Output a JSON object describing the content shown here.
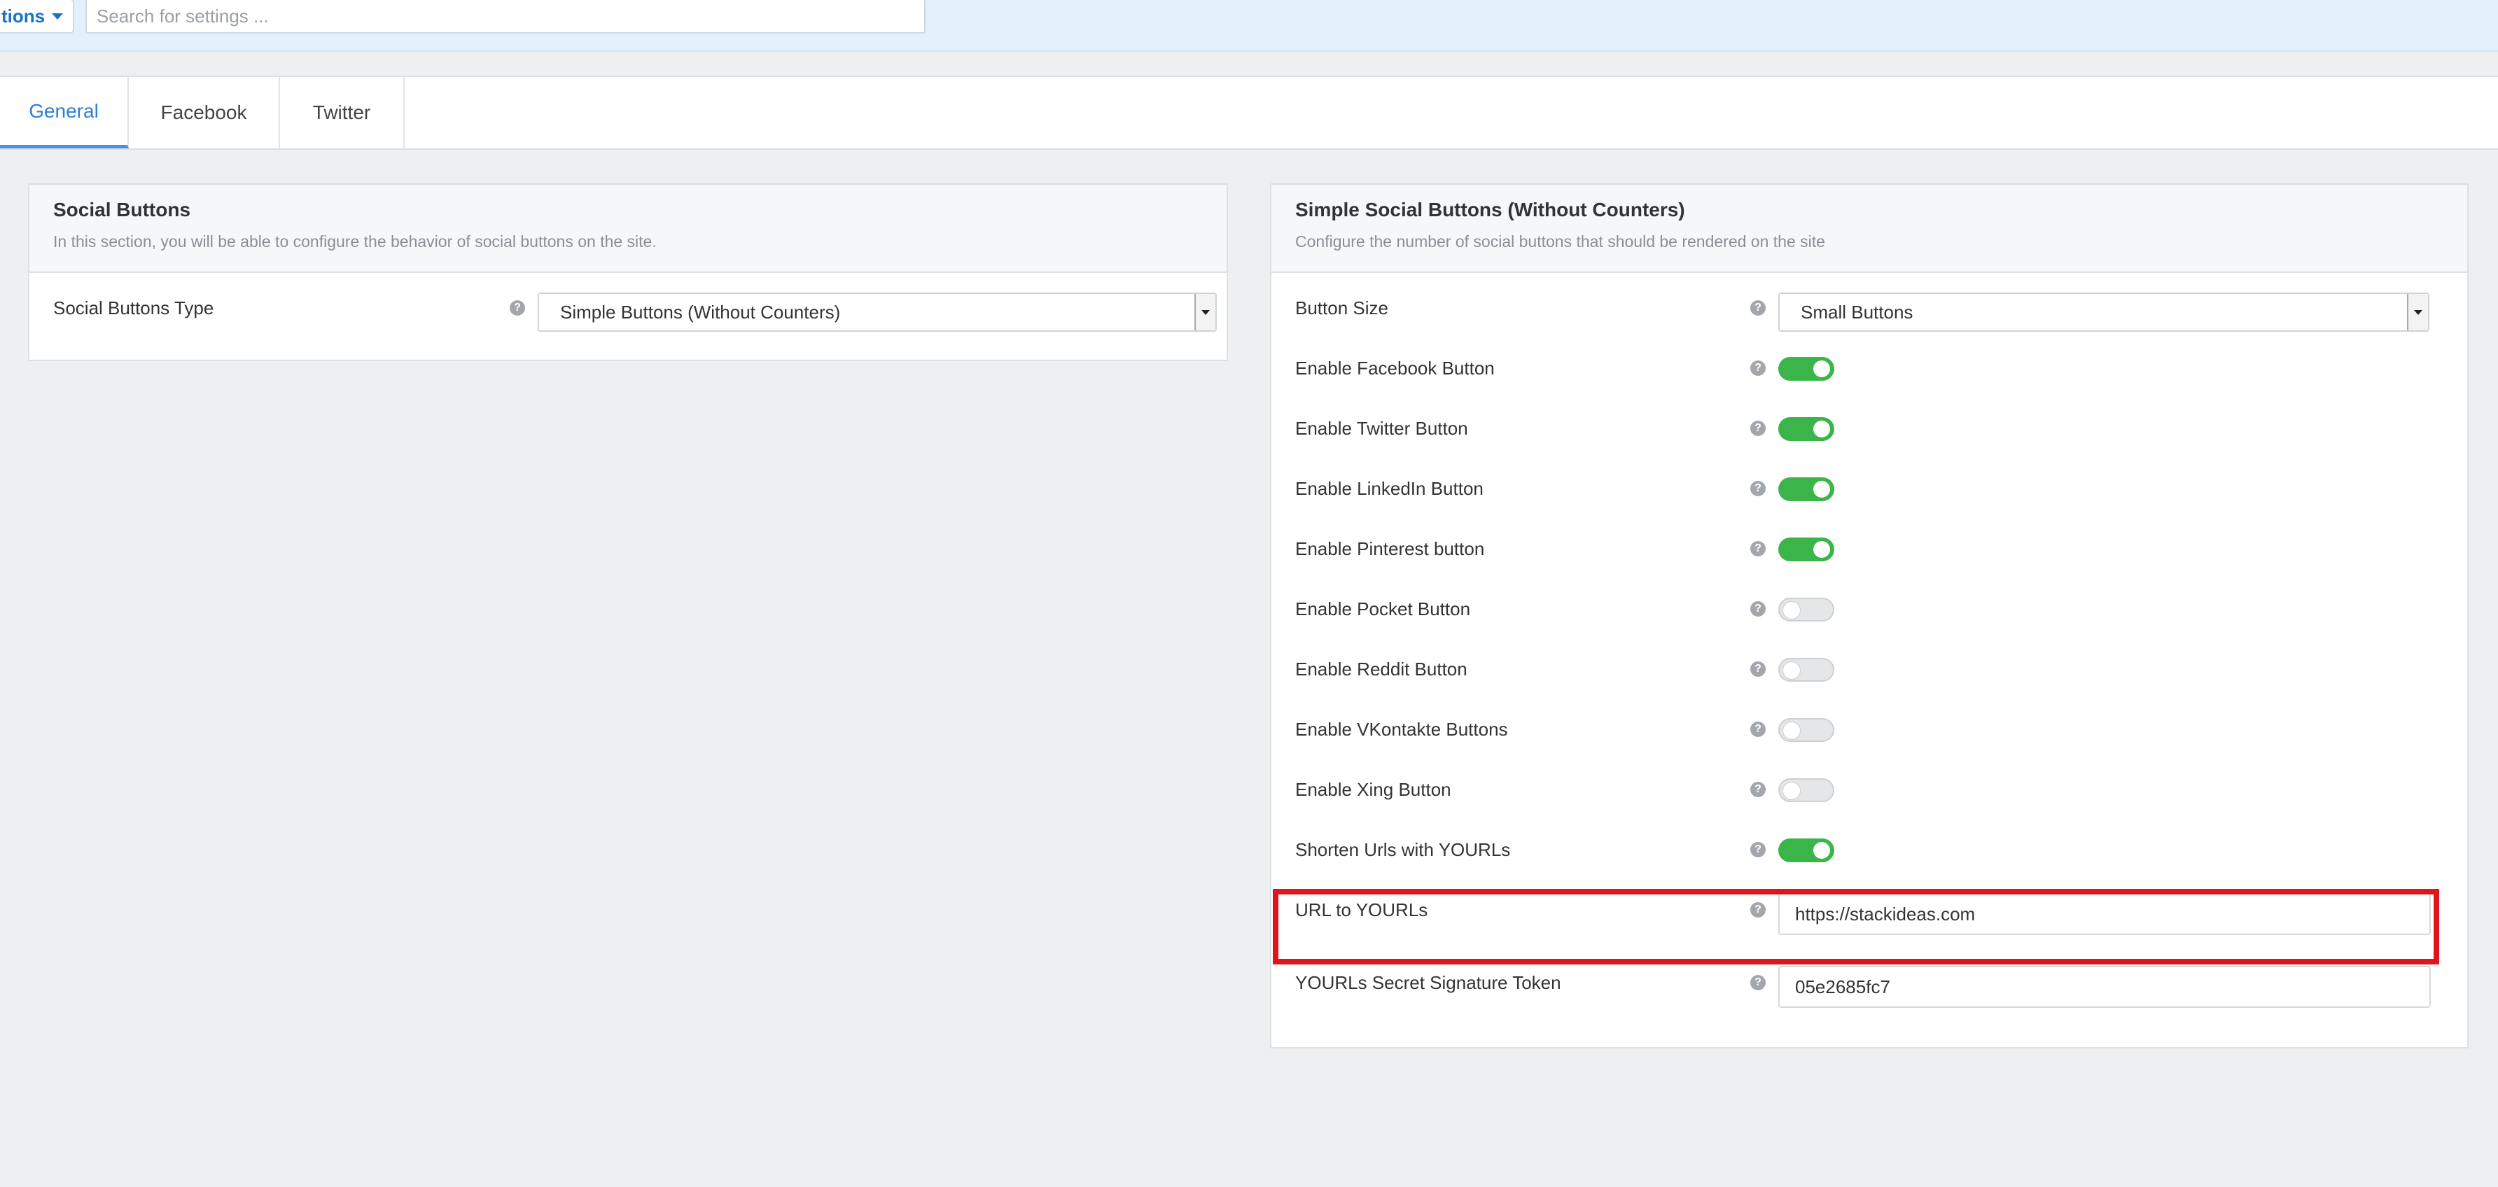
{
  "topbar": {
    "options_label": "tions",
    "search_placeholder": "Search for settings ..."
  },
  "tabs": [
    {
      "label": "General",
      "active": true
    },
    {
      "label": "Facebook",
      "active": false
    },
    {
      "label": "Twitter",
      "active": false
    }
  ],
  "left_panel": {
    "title": "Social Buttons",
    "description": "In this section, you will be able to configure the behavior of social buttons on the site.",
    "rows": [
      {
        "label": "Social Buttons Type",
        "value": "Simple Buttons (Without Counters)"
      }
    ]
  },
  "right_panel": {
    "title": "Simple Social Buttons (Without Counters)",
    "description": "Configure the number of social buttons that should be rendered on the site",
    "button_size": {
      "label": "Button Size",
      "value": "Small Buttons"
    },
    "toggles": [
      {
        "label": "Enable Facebook Button",
        "on": true
      },
      {
        "label": "Enable Twitter Button",
        "on": true
      },
      {
        "label": "Enable LinkedIn Button",
        "on": true
      },
      {
        "label": "Enable Pinterest button",
        "on": true
      },
      {
        "label": "Enable Pocket Button",
        "on": false
      },
      {
        "label": "Enable Reddit Button",
        "on": false
      },
      {
        "label": "Enable VKontakte Buttons",
        "on": false
      },
      {
        "label": "Enable Xing Button",
        "on": false
      },
      {
        "label": "Shorten Urls with YOURLs",
        "on": true
      }
    ],
    "yourls_url": {
      "label": "URL to YOURLs",
      "value": "https://stackideas.com"
    },
    "yourls_token": {
      "label": "YOURLs Secret Signature Token",
      "value": "05e2685fc7"
    }
  },
  "help_icon_glyph": "?",
  "colors": {
    "accent": "#2f7fd3",
    "toggle_on": "#3bb54a",
    "highlight": "#e0141b"
  }
}
